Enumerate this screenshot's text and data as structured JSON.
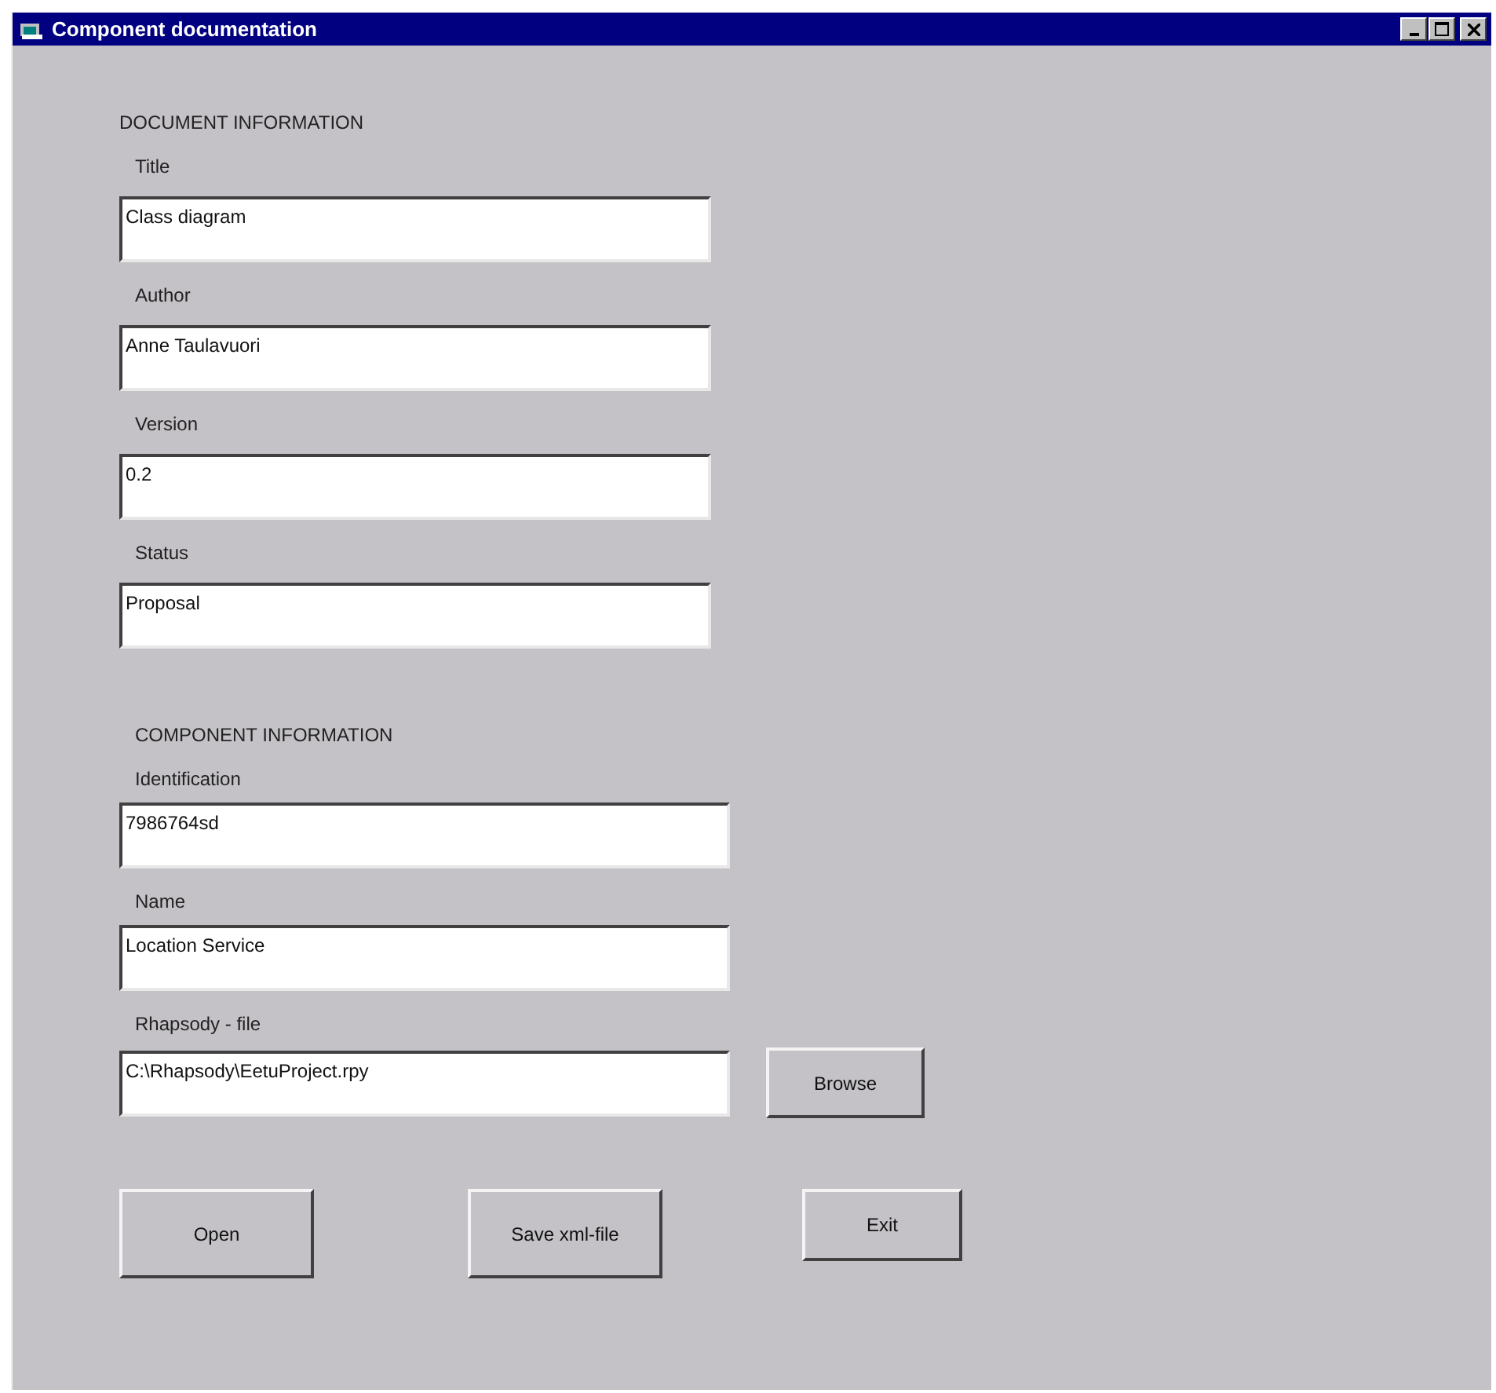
{
  "window": {
    "title": "Component documentation"
  },
  "document_section": {
    "heading": "DOCUMENT INFORMATION",
    "fields": [
      {
        "label": "Title",
        "value": "Class diagram"
      },
      {
        "label": "Author",
        "value": "Anne Taulavuori"
      },
      {
        "label": "Version",
        "value": "0.2"
      },
      {
        "label": "Status",
        "value": "Proposal"
      }
    ]
  },
  "component_section": {
    "heading": "COMPONENT INFORMATION",
    "fields": [
      {
        "label": "Identification",
        "value": "7986764sd"
      },
      {
        "label": "Name",
        "value": "Location Service"
      },
      {
        "label": "Rhapsody - file",
        "value": "C:\\Rhapsody\\EetuProject.rpy",
        "button": "Browse"
      }
    ]
  },
  "buttons": [
    {
      "label": "Open",
      "kind": "tall"
    },
    {
      "label": "Save xml-file",
      "kind": "tall"
    },
    {
      "label": "Exit",
      "kind": "short"
    }
  ]
}
